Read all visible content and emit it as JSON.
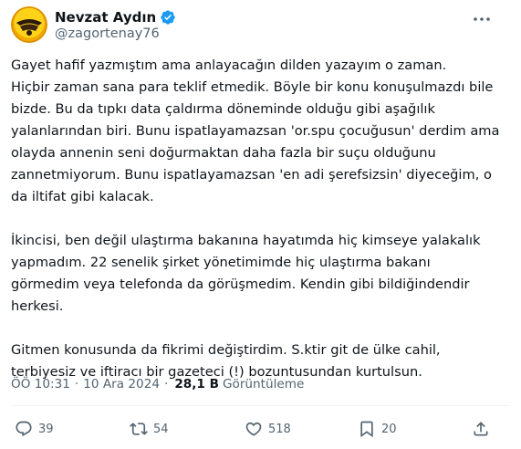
{
  "user": {
    "name": "Nevzat Aydın",
    "handle": "@zagortenay76"
  },
  "tweet": {
    "paragraphs": [
      [
        "Gayet hafif yazmıştım ama anlayacağın dilden yazayım o zaman.",
        "Hiçbir zaman sana para teklif etmedik. Böyle bir konu konuşulmazdı bile",
        "bizde. Bu da tıpkı data çaldırma döneminde olduğu gibi aşağılık",
        "yalanlarından biri. Bunu ispatlayamazsan 'or.spu çocuğusun' derdim ama",
        "olayda annenin seni doğurmaktan daha fazla bir suçu olduğunu",
        "zannetmiyorum. Bunu ispatlayamazsan 'en adi şerefsizsin' diyeceğim, o",
        "da iltifat gibi kalacak."
      ],
      [
        "İkincisi, ben değil ulaştırma bakanına hayatımda hiç kimseye yalakalık",
        "yapmadım. 22 senelik şirket yönetimimde hiç ulaştırma bakanı",
        "görmedim veya telefonda da görüşmedim. Kendin gibi bildiğindendir",
        "herkesi."
      ],
      [
        "Gitmen konusunda da fikrimi değiştirdim. S.ktir git de ülke cahil,",
        "terbiyesiz ve iftiracı bir gazeteci (!) bozuntusundan kurtulsun."
      ]
    ]
  },
  "meta": {
    "time": "ÖÖ 10:31",
    "separator": "·",
    "date": "10 Ara 2024",
    "views_count": "28,1 B",
    "views_label": "Görüntüleme"
  },
  "actions": {
    "replies": "39",
    "retweets": "54",
    "likes": "518",
    "bookmarks": "20"
  },
  "colors": {
    "text": "#0f1419",
    "secondary": "#536471",
    "verified": "#1d9bf0",
    "divider": "#eff3f4"
  },
  "icons": [
    "avatar-logo",
    "verified-badge-icon",
    "more-icon",
    "reply-icon",
    "retweet-icon",
    "like-icon",
    "bookmark-icon",
    "share-icon"
  ]
}
